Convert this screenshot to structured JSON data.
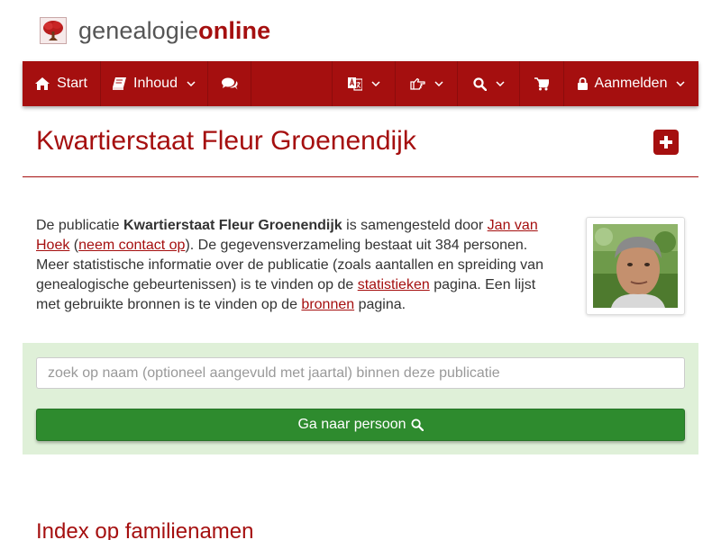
{
  "brand": {
    "name_part1": "genealogie",
    "name_part2": "online",
    "logo_icon": "tree-icon"
  },
  "nav": {
    "start_label": "Start",
    "start_icon": "home-icon",
    "inhoud_label": "Inhoud",
    "inhoud_icon": "book-icon",
    "chat_icon": "comments-icon",
    "language_icon": "translate-icon",
    "like_icon": "hand-pointer-icon",
    "search_icon": "search-icon",
    "cart_icon": "shopping-cart-icon",
    "login_label": "Aanmelden",
    "login_icon": "lock-icon",
    "color": "#a50f0f"
  },
  "page": {
    "title": "Kwartierstaat Fleur Groenendijk",
    "add_icon": "plus-square-icon"
  },
  "intro": {
    "t1": "De publicatie ",
    "pub_name": "Kwartierstaat Fleur Groenendijk",
    "t2": " is samengesteld door ",
    "author_link": "Jan van Hoek",
    "t3": " (",
    "contact_link": "neem contact op",
    "t4": "). De gegevensverzameling bestaat uit 384 personen. Meer statistische informatie over de publicatie (zoals aantallen en spreiding van genealogische gebeurtenissen) is te vinden op de ",
    "stats_link": "statistieken",
    "t5": " pagina. Een lijst met gebruikte bronnen is te vinden op de ",
    "sources_link": "bronnen",
    "t6": " pagina."
  },
  "search": {
    "placeholder": "zoek op naam (optioneel aangevuld met jaartal) binnen deze publicatie",
    "value": "",
    "button_label": "Ga naar persoon",
    "button_color": "#2e8b2e",
    "panel_color": "#dff0d8"
  },
  "index": {
    "heading": "Index op familienamen"
  }
}
